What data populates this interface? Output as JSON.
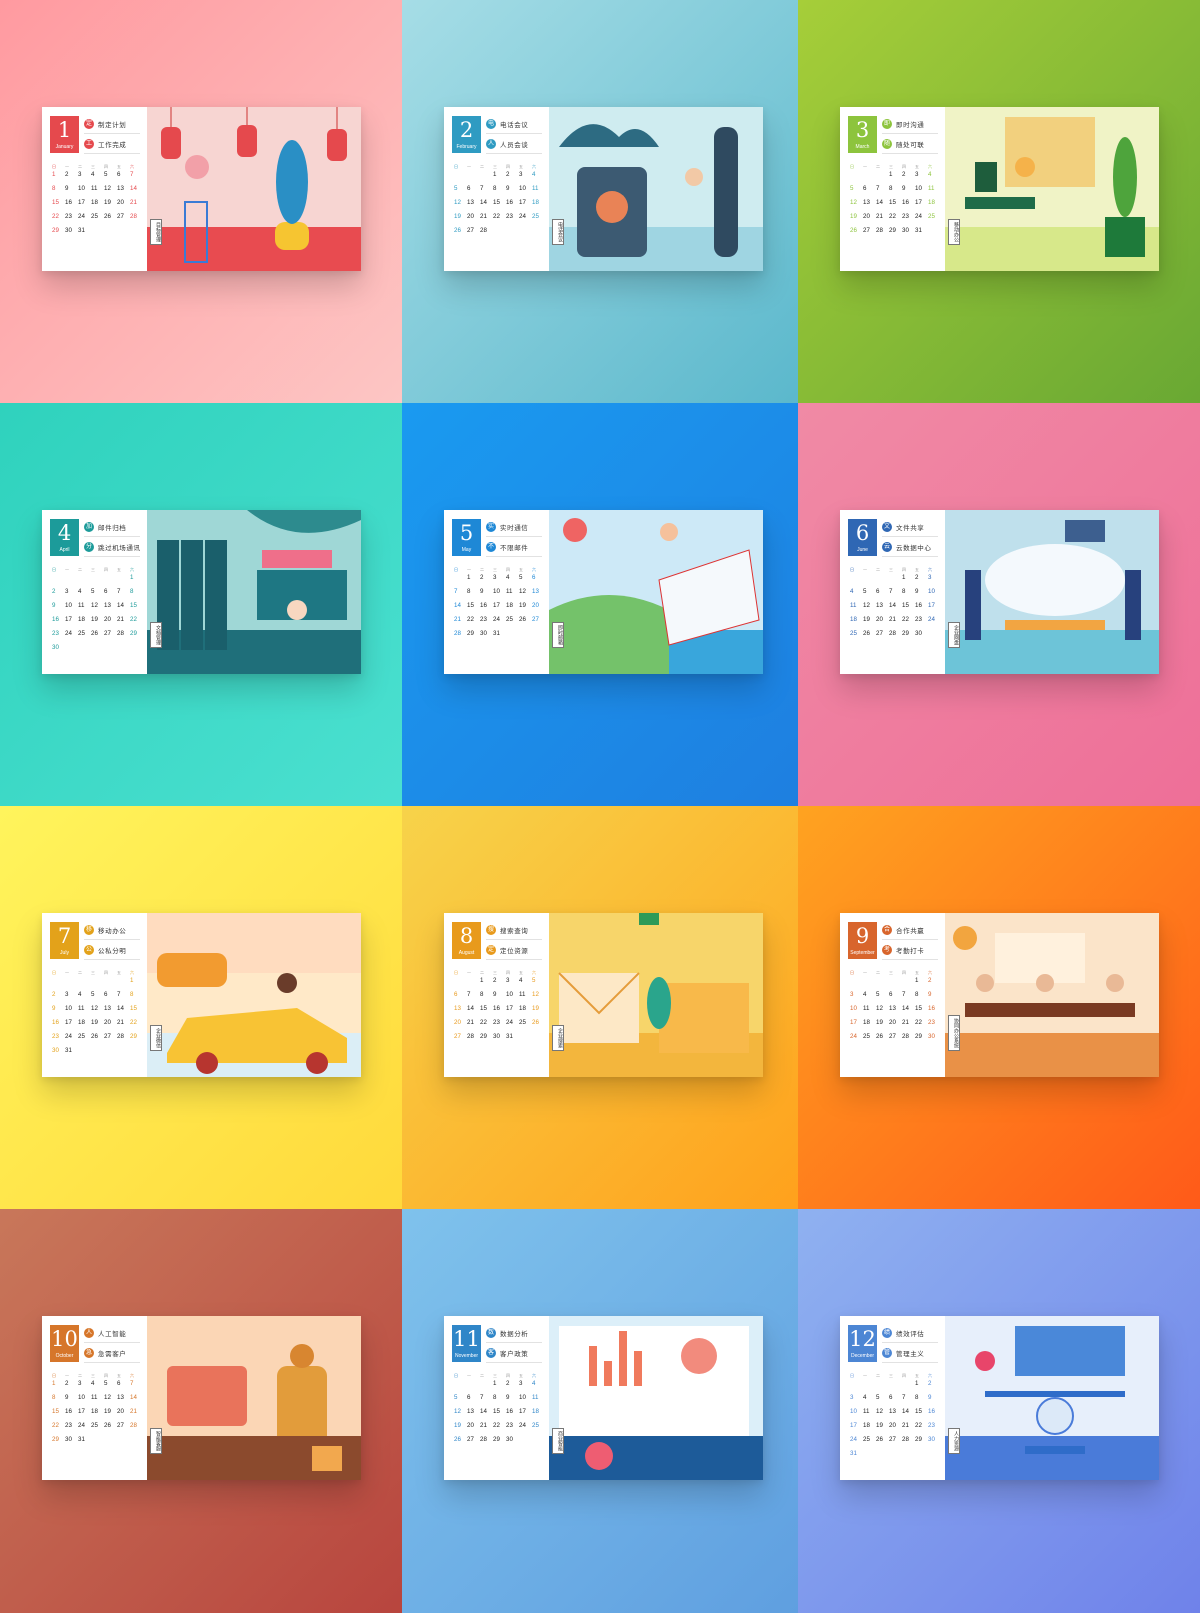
{
  "months": [
    {
      "num": "1",
      "name": "January",
      "accent": "#e5494d",
      "bg_from": "#ff9aa0",
      "bg_to": "#fdc6c4",
      "illu": "#f7d5d2",
      "illu_floor": "#e84b50",
      "badge1": "定",
      "task1": "制定计划",
      "badge2": "工",
      "task2": "工作完成",
      "tag": "目标管理",
      "first": 0,
      "days": 31,
      "scene": "lanterns"
    },
    {
      "num": "2",
      "name": "February",
      "accent": "#2f9bc2",
      "bg_from": "#a6dde6",
      "bg_to": "#5bb8cc",
      "illu": "#cfecf0",
      "illu_floor": "#9fd5e2",
      "badge1": "电",
      "task1": "电话会议",
      "badge2": "人",
      "task2": "人员会谈",
      "tag": "电话会议",
      "first": 3,
      "days": 28,
      "scene": "phone"
    },
    {
      "num": "3",
      "name": "March",
      "accent": "#8dc43d",
      "bg_from": "#a6ce39",
      "bg_to": "#69a833",
      "illu": "#f0f3c6",
      "illu_floor": "#d7e88a",
      "badge1": "即",
      "task1": "即时沟通",
      "badge2": "随",
      "task2": "随处可联",
      "tag": "移动办公",
      "first": 3,
      "days": 31,
      "scene": "desk"
    },
    {
      "num": "4",
      "name": "April",
      "accent": "#1c9b9a",
      "bg_from": "#2fd2bd",
      "bg_to": "#4be0d0",
      "illu": "#9fd7d6",
      "illu_floor": "#1f6f7a",
      "badge1": "加",
      "task1": "邮件归档",
      "badge2": "分",
      "task2": "跳过机场通讯",
      "tag": "文档管理",
      "first": 6,
      "days": 30,
      "scene": "archive"
    },
    {
      "num": "5",
      "name": "May",
      "accent": "#1e88d6",
      "bg_from": "#1a9af0",
      "bg_to": "#1e7fe0",
      "illu": "#cde9f7",
      "illu_floor": "#39a6dc",
      "badge1": "实",
      "task1": "实时通信",
      "badge2": "不",
      "task2": "不限邮件",
      "tag": "即时邮箱",
      "first": 1,
      "days": 31,
      "scene": "mail"
    },
    {
      "num": "6",
      "name": "June",
      "accent": "#2f67b4",
      "bg_from": "#f08aa5",
      "bg_to": "#ee6f98",
      "illu": "#bfe0ec",
      "illu_floor": "#6dc4d8",
      "badge1": "文",
      "task1": "文件共享",
      "badge2": "云",
      "task2": "云数据中心",
      "tag": "企业网盘",
      "first": 4,
      "days": 30,
      "scene": "cloud"
    },
    {
      "num": "7",
      "name": "July",
      "accent": "#e3a21a",
      "bg_from": "#fff45c",
      "bg_to": "#ffd93b",
      "illu": "#ffe9c8",
      "illu_floor": "#dbeef6",
      "badge1": "移",
      "task1": "移动办公",
      "badge2": "公",
      "task2": "公私分明",
      "tag": "企业微信",
      "first": 6,
      "days": 31,
      "scene": "car"
    },
    {
      "num": "8",
      "name": "August",
      "accent": "#e89a1c",
      "bg_from": "#f7d34a",
      "bg_to": "#ffa11c",
      "illu": "#f7d56a",
      "illu_floor": "#f3b63d",
      "badge1": "搜",
      "task1": "搜索查询",
      "badge2": "定",
      "task2": "定位资源",
      "tag": "企业搜索",
      "first": 2,
      "days": 31,
      "scene": "envelopes"
    },
    {
      "num": "9",
      "name": "September",
      "accent": "#d8652c",
      "bg_from": "#ffa320",
      "bg_to": "#ff5a19",
      "illu": "#fbe4c9",
      "illu_floor": "#e99147",
      "badge1": "合",
      "task1": "合作共赢",
      "badge2": "考",
      "task2": "考勤打卡",
      "tag": "协同办公系统",
      "first": 5,
      "days": 30,
      "scene": "meeting"
    },
    {
      "num": "10",
      "name": "October",
      "accent": "#d6762a",
      "bg_from": "#c8775a",
      "bg_to": "#b8453e",
      "illu": "#fbd6b5",
      "illu_floor": "#8b4a2d",
      "badge1": "人",
      "task1": "人工智能",
      "badge2": "急",
      "task2": "急需客户",
      "tag": "智能客服",
      "first": 0,
      "days": 31,
      "scene": "robot"
    },
    {
      "num": "11",
      "name": "November",
      "accent": "#2f86c8",
      "bg_from": "#7fc2ec",
      "bg_to": "#5f9fe0",
      "illu": "#dceff9",
      "illu_floor": "#2268a6",
      "badge1": "数",
      "task1": "数据分析",
      "badge2": "客",
      "task2": "客户政策",
      "tag": "商业智能",
      "first": 3,
      "days": 30,
      "scene": "chart"
    },
    {
      "num": "12",
      "name": "December",
      "accent": "#4c86d4",
      "bg_from": "#8fb1f0",
      "bg_to": "#6f82ea",
      "illu": "#e7effb",
      "illu_floor": "#4a7bd9",
      "badge1": "绩",
      "task1": "绩效评估",
      "badge2": "管",
      "task2": "管理主义",
      "tag": "人力资源",
      "first": 5,
      "days": 31,
      "scene": "scale"
    }
  ],
  "weekdays": [
    "日",
    "一",
    "二",
    "三",
    "四",
    "五",
    "六"
  ]
}
